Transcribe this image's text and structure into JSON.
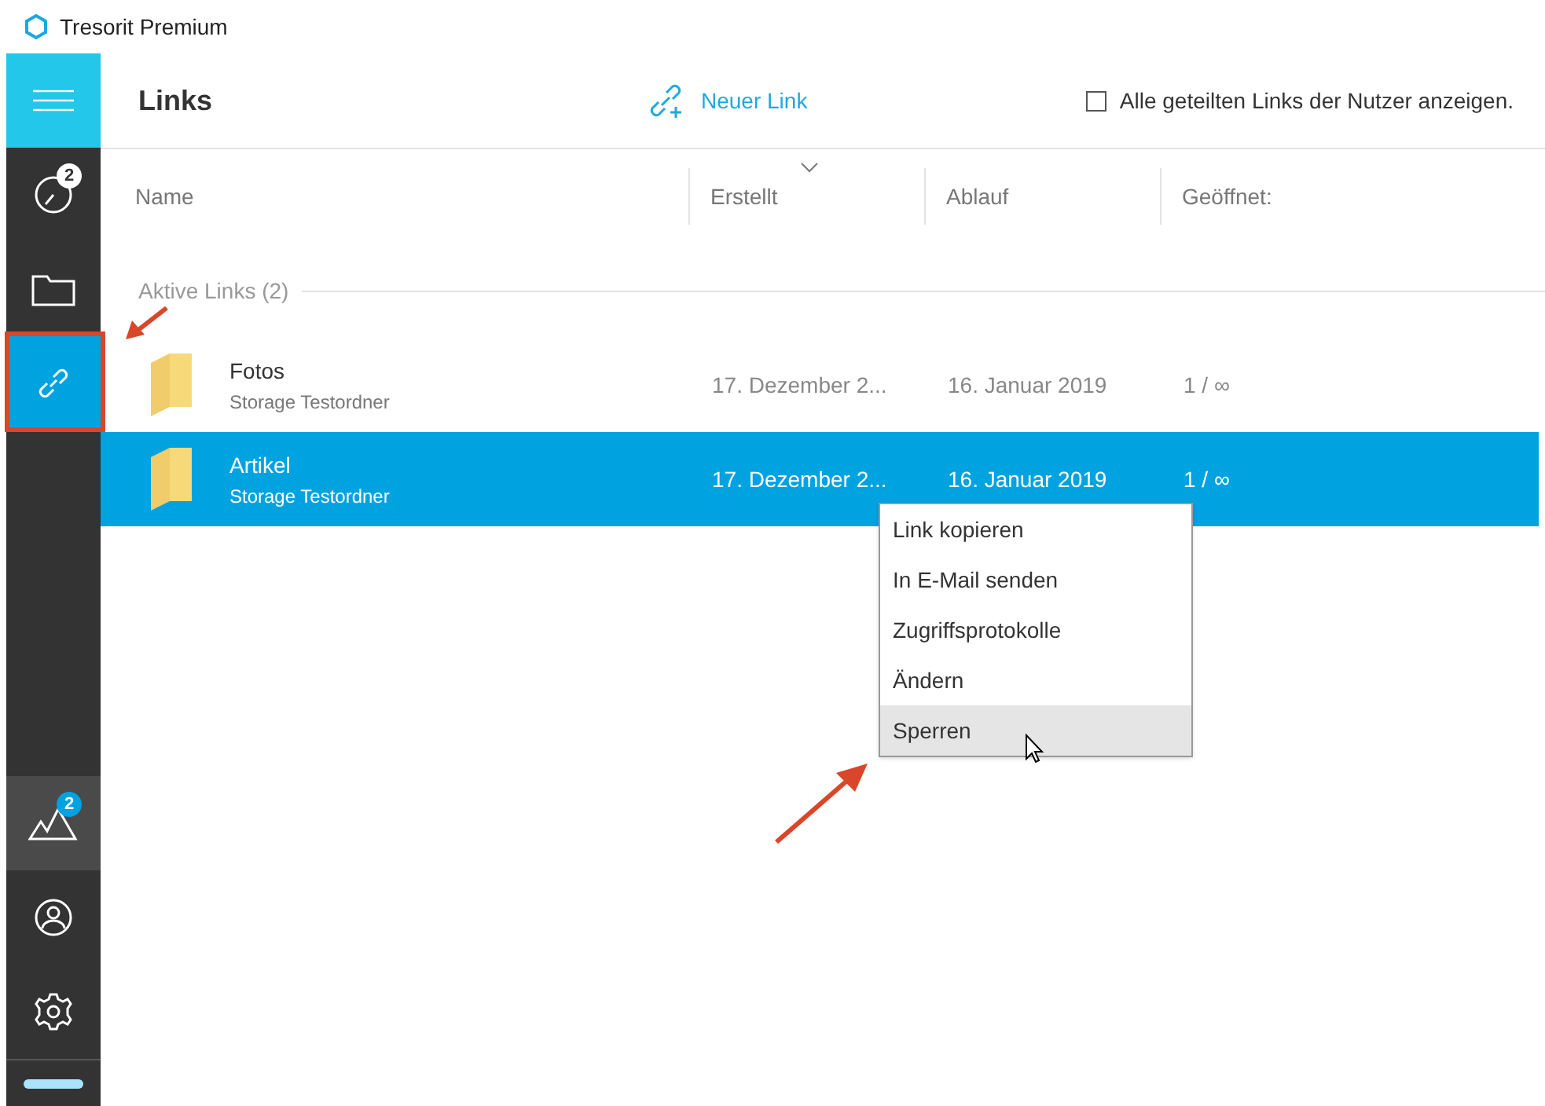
{
  "window": {
    "title": "Tresorit Premium"
  },
  "sidebar": {
    "items": [
      {
        "kind": "recent",
        "selected": false,
        "badge": "2"
      },
      {
        "kind": "folder",
        "selected": false
      },
      {
        "kind": "links",
        "selected": true
      }
    ],
    "bottom_items": [
      {
        "kind": "mountains",
        "selected": true,
        "badge": "2"
      },
      {
        "kind": "profile",
        "selected": false
      },
      {
        "kind": "settings",
        "selected": false
      }
    ]
  },
  "header": {
    "title": "Links",
    "new_link": "Neuer Link",
    "show_all": {
      "label": "Alle geteilten Links der Nutzer anzeigen.",
      "checked": false
    }
  },
  "table": {
    "columns": [
      {
        "label": "Name",
        "sorted": false
      },
      {
        "label": "Erstellt",
        "sorted": true
      },
      {
        "label": "Ablauf",
        "sorted": false
      },
      {
        "label": "Geöffnet:",
        "sorted": false
      }
    ],
    "section": "Aktive Links (2)",
    "rows": [
      {
        "name": "Fotos",
        "location": "Storage Testordner",
        "created": "17. Dezember 2...",
        "expires": "16. Januar 2019",
        "opened": "1 / ∞",
        "selected": false
      },
      {
        "name": "Artikel",
        "location": "Storage Testordner",
        "created": "17. Dezember 2...",
        "expires": "16. Januar 2019",
        "opened": "1 / ∞",
        "selected": true
      }
    ]
  },
  "context_menu": {
    "items": [
      {
        "label": "Link kopieren",
        "selected": false
      },
      {
        "label": "In E-Mail senden",
        "selected": false
      },
      {
        "label": "Zugriffsprotokolle",
        "selected": false
      },
      {
        "label": "Ändern",
        "selected": false
      },
      {
        "label": "Sperren",
        "selected": true
      }
    ]
  }
}
